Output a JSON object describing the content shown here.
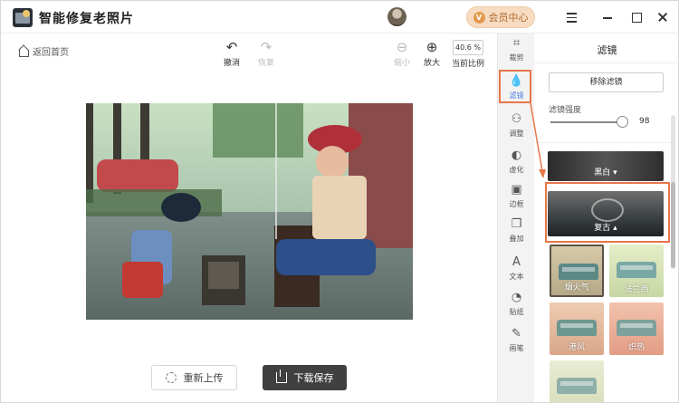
{
  "app": {
    "title": "智能修复老照片"
  },
  "header": {
    "vip_label": "会员中心"
  },
  "toolbar": {
    "back_home": "返回首页",
    "undo": "撤消",
    "redo": "恢复",
    "zoom_out": "缩小",
    "zoom_in": "放大",
    "zoom_value": "40.6 %",
    "zoom_ratio_label": "当前比例"
  },
  "actions": {
    "reupload": "重新上传",
    "download": "下载保存"
  },
  "sidenav": {
    "items": [
      {
        "label": "裁剪",
        "icon": "crop-icon"
      },
      {
        "label": "滤镜",
        "icon": "filter-drop-icon",
        "active": true
      },
      {
        "label": "调整",
        "icon": "adjust-icon"
      },
      {
        "label": "虚化",
        "icon": "blur-icon"
      },
      {
        "label": "边框",
        "icon": "frame-icon"
      },
      {
        "label": "叠加",
        "icon": "overlay-icon"
      },
      {
        "label": "文本",
        "icon": "text-icon"
      },
      {
        "label": "贴纸",
        "icon": "sticker-icon"
      },
      {
        "label": "画笔",
        "icon": "brush-icon"
      }
    ]
  },
  "filter_panel": {
    "title": "滤镜",
    "remove_filter": "移除滤镜",
    "strength_label": "滤镜强度",
    "strength_value": "98",
    "strength_fraction": 0.98,
    "categories": [
      {
        "label": "黑白 ▾"
      },
      {
        "label": "复古 ▴",
        "selected": true
      }
    ],
    "thumbnails": [
      {
        "label": "烟火气",
        "selected": true
      },
      {
        "label": "法兰西"
      },
      {
        "label": "港风"
      },
      {
        "label": "炽热"
      },
      {
        "label": ""
      }
    ]
  },
  "colors": {
    "accent": "#4a7be0",
    "highlight": "#e8764a",
    "primary_button": "#404040"
  }
}
